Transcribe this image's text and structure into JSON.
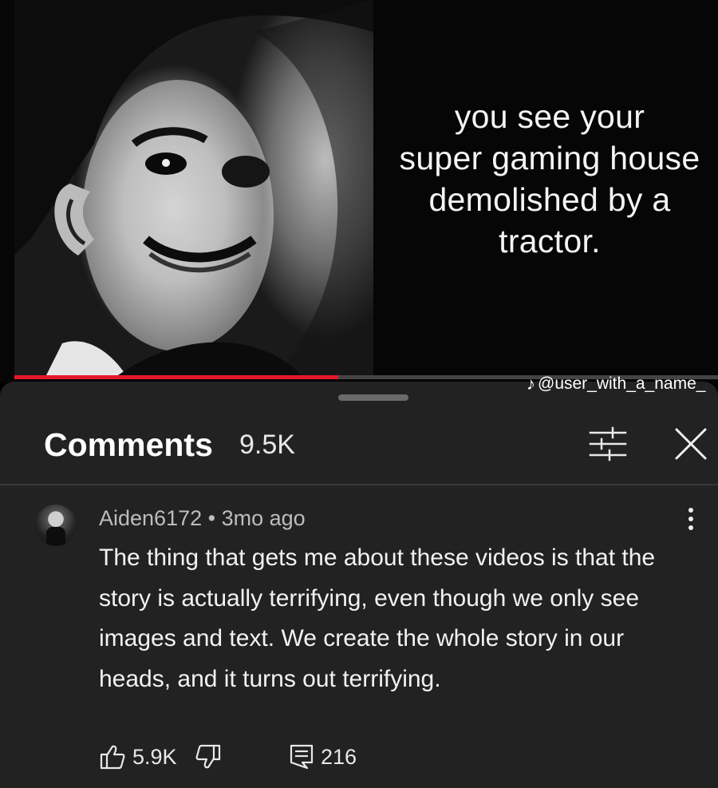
{
  "video": {
    "caption": "you see your\nsuper gaming house\ndemolished by a\ntractor.",
    "progress_fraction": 0.46
  },
  "comments_panel": {
    "title": "Comments",
    "count": "9.5K",
    "icons": {
      "filter": "sort-filter-icon",
      "close": "close-icon"
    }
  },
  "comment": {
    "author": "Aiden6172",
    "separator": "•",
    "age": "3mo ago",
    "text": "The thing that gets me about these videos is that the story is actually terrifying, even though we only see images and text. We create the whole story in our heads, and it turns out terrifying.",
    "likes": "5.9K",
    "replies": "216",
    "icons": {
      "like": "thumbs-up-icon",
      "dislike": "thumbs-down-icon",
      "replies": "reply-icon",
      "more": "more-vertical-icon"
    }
  },
  "watermark": {
    "handle": "@user_with_a_name_",
    "icon": "tiktok-icon"
  },
  "colors": {
    "panel_bg": "#222222",
    "progress_red": "#e3182a",
    "text_primary": "#f1f1f1",
    "text_secondary": "#bdbdbd"
  }
}
